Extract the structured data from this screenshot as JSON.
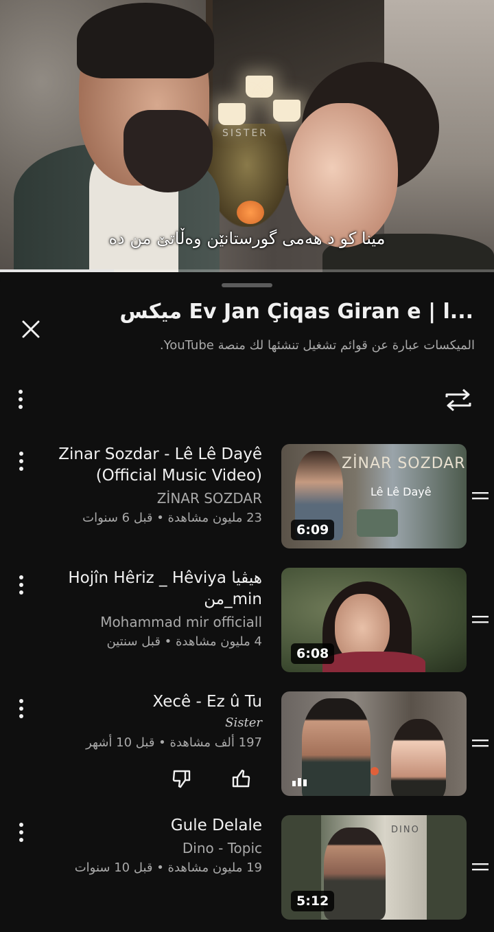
{
  "player": {
    "watermark": "SISTER",
    "subtitle": "مینا کو د هەمی گورستانێن وەڵاتێ من دە",
    "progress": 0.23
  },
  "panel": {
    "title": "میکس Ev Jan Çiqas Giran e | ا...",
    "subtitle": "الميكسات عبارة عن قوائم تشغيل تنشئها لك منصة YouTube.",
    "icons": {
      "close": "close-icon",
      "more": "more-vert-icon",
      "repeat": "repeat-icon",
      "drag": "drag-handle-icon",
      "like": "thumb-up-icon",
      "dislike": "thumb-down-icon",
      "playing": "now-playing-bars-icon"
    },
    "items": [
      {
        "title": "Zinar Sozdar - Lê Lê Dayê (Official Music Video)",
        "channel": "ZİNAR SOZDAR",
        "meta": "23 مليون مشاهدة • قبل 6 سنوات",
        "duration": "6:09",
        "thumb_overlay": "ZİNAR SOZDAR",
        "thumb_sub": "Lê Lê Dayê"
      },
      {
        "title": "Hojîn Hêriz _  Hêviya هیڤیا من_min",
        "channel": "Mohammad mir officiall",
        "meta": "4 مليون مشاهدة • قبل سنتين",
        "duration": "6:08"
      },
      {
        "title": "Xecê - Ez û Tu",
        "channel": "Sister",
        "meta": "197 ألف مشاهدة • قبل 10 أشهر",
        "now_playing": true
      },
      {
        "title": "Gule Delale",
        "channel": "Dino - Topic",
        "meta": "19 مليون مشاهدة • قبل 10 سنوات",
        "duration": "5:12",
        "thumb_overlay": "DINO"
      }
    ]
  }
}
